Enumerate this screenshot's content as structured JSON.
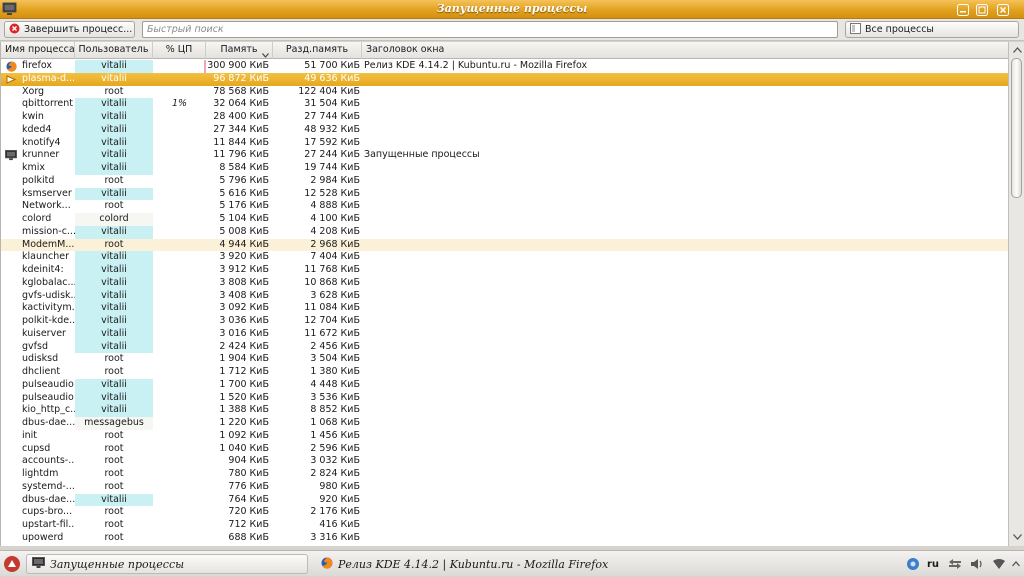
{
  "window": {
    "title": "Запущенные процессы",
    "app_icon": "monitor-icon",
    "buttons": [
      "minimize-icon",
      "maximize-icon",
      "close-icon"
    ],
    "accent": "#e2a21f"
  },
  "toolbar": {
    "kill_label": "Завершить процесс...",
    "search_placeholder": "Быстрый поиск",
    "search_value": "",
    "filter_label": "Все процессы"
  },
  "columns": {
    "name": "Имя процесса",
    "user": "Пользователь",
    "cpu": "% ЦП",
    "mem": "Память",
    "shared": "Разд.память",
    "title": "Заголовок окна"
  },
  "rows": [
    {
      "name": "firefox",
      "user": "vitalii",
      "cpu": "",
      "mem": "300 900 КиБ",
      "shared": "51 700 КиБ",
      "title": "Релиз KDE 4.14.2 |  Kubuntu.ru - Mozilla Firefox",
      "icon": "firefox-icon",
      "mem_frac": 1.0
    },
    {
      "name": "plasma-d...",
      "user": "vitalii",
      "cpu": "",
      "mem": "96 872 КиБ",
      "shared": "49 636 КиБ",
      "title": "",
      "icon": "plasma-icon",
      "mem_frac": 0.32,
      "selected": true
    },
    {
      "name": "Xorg",
      "user": "root",
      "cpu": "",
      "mem": "78 568 КиБ",
      "shared": "122 404 КиБ",
      "title": ""
    },
    {
      "name": "qbittorrent",
      "user": "vitalii",
      "cpu": "1%",
      "mem": "32 064 КиБ",
      "shared": "31 504 КиБ",
      "title": ""
    },
    {
      "name": "kwin",
      "user": "vitalii",
      "cpu": "",
      "mem": "28 400 КиБ",
      "shared": "27 744 КиБ",
      "title": ""
    },
    {
      "name": "kded4",
      "user": "vitalii",
      "cpu": "",
      "mem": "27 344 КиБ",
      "shared": "48 932 КиБ",
      "title": ""
    },
    {
      "name": "knotify4",
      "user": "vitalii",
      "cpu": "",
      "mem": "11 844 КиБ",
      "shared": "17 592 КиБ",
      "title": ""
    },
    {
      "name": "krunner",
      "user": "vitalii",
      "cpu": "",
      "mem": "11 796 КиБ",
      "shared": "27 244 КиБ",
      "title": "Запущенные процессы",
      "icon": "monitor-icon"
    },
    {
      "name": "kmix",
      "user": "vitalii",
      "cpu": "",
      "mem": "8 584 КиБ",
      "shared": "19 744 КиБ",
      "title": ""
    },
    {
      "name": "polkitd",
      "user": "root",
      "cpu": "",
      "mem": "5 796 КиБ",
      "shared": "2 984 КиБ",
      "title": ""
    },
    {
      "name": "ksmserver",
      "user": "vitalii",
      "cpu": "",
      "mem": "5 616 КиБ",
      "shared": "12 528 КиБ",
      "title": ""
    },
    {
      "name": "Network...",
      "user": "root",
      "cpu": "",
      "mem": "5 176 КиБ",
      "shared": "4 888 КиБ",
      "title": ""
    },
    {
      "name": "colord",
      "user": "colord",
      "cpu": "",
      "mem": "5 104 КиБ",
      "shared": "4 100 КиБ",
      "title": ""
    },
    {
      "name": "mission-c...",
      "user": "vitalii",
      "cpu": "",
      "mem": "5 008 КиБ",
      "shared": "4 208 КиБ",
      "title": ""
    },
    {
      "name": "ModemM...",
      "user": "root",
      "cpu": "",
      "mem": "4 944 КиБ",
      "shared": "2 968 КиБ",
      "title": "",
      "hover": true
    },
    {
      "name": "klauncher",
      "user": "vitalii",
      "cpu": "",
      "mem": "3 920 КиБ",
      "shared": "7 404 КиБ",
      "title": ""
    },
    {
      "name": "kdeinit4:",
      "user": "vitalii",
      "cpu": "",
      "mem": "3 912 КиБ",
      "shared": "11 768 КиБ",
      "title": ""
    },
    {
      "name": "kglobalac...",
      "user": "vitalii",
      "cpu": "",
      "mem": "3 808 КиБ",
      "shared": "10 868 КиБ",
      "title": ""
    },
    {
      "name": "gvfs-udisk...",
      "user": "vitalii",
      "cpu": "",
      "mem": "3 408 КиБ",
      "shared": "3 628 КиБ",
      "title": ""
    },
    {
      "name": "kactivitym...",
      "user": "vitalii",
      "cpu": "",
      "mem": "3 092 КиБ",
      "shared": "11 084 КиБ",
      "title": ""
    },
    {
      "name": "polkit-kde...",
      "user": "vitalii",
      "cpu": "",
      "mem": "3 036 КиБ",
      "shared": "12 704 КиБ",
      "title": ""
    },
    {
      "name": "kuiserver",
      "user": "vitalii",
      "cpu": "",
      "mem": "3 016 КиБ",
      "shared": "11 672 КиБ",
      "title": ""
    },
    {
      "name": "gvfsd",
      "user": "vitalii",
      "cpu": "",
      "mem": "2 424 КиБ",
      "shared": "2 456 КиБ",
      "title": ""
    },
    {
      "name": "udisksd",
      "user": "root",
      "cpu": "",
      "mem": "1 904 КиБ",
      "shared": "3 504 КиБ",
      "title": ""
    },
    {
      "name": "dhclient",
      "user": "root",
      "cpu": "",
      "mem": "1 712 КиБ",
      "shared": "1 380 КиБ",
      "title": ""
    },
    {
      "name": "pulseaudio",
      "user": "vitalii",
      "cpu": "",
      "mem": "1 700 КиБ",
      "shared": "4 448 КиБ",
      "title": ""
    },
    {
      "name": "pulseaudio",
      "user": "vitalii",
      "cpu": "",
      "mem": "1 520 КиБ",
      "shared": "3 536 КиБ",
      "title": ""
    },
    {
      "name": "kio_http_c...",
      "user": "vitalii",
      "cpu": "",
      "mem": "1 388 КиБ",
      "shared": "8 852 КиБ",
      "title": ""
    },
    {
      "name": "dbus-dae...",
      "user": "messagebus",
      "cpu": "",
      "mem": "1 220 КиБ",
      "shared": "1 068 КиБ",
      "title": ""
    },
    {
      "name": "init",
      "user": "root",
      "cpu": "",
      "mem": "1 092 КиБ",
      "shared": "1 456 КиБ",
      "title": ""
    },
    {
      "name": "cupsd",
      "user": "root",
      "cpu": "",
      "mem": "1 040 КиБ",
      "shared": "2 596 КиБ",
      "title": ""
    },
    {
      "name": "accounts-...",
      "user": "root",
      "cpu": "",
      "mem": "904 КиБ",
      "shared": "3 032 КиБ",
      "title": ""
    },
    {
      "name": "lightdm",
      "user": "root",
      "cpu": "",
      "mem": "780 КиБ",
      "shared": "2 824 КиБ",
      "title": ""
    },
    {
      "name": "systemd-...",
      "user": "root",
      "cpu": "",
      "mem": "776 КиБ",
      "shared": "980 КиБ",
      "title": ""
    },
    {
      "name": "dbus-dae...",
      "user": "vitalii",
      "cpu": "",
      "mem": "764 КиБ",
      "shared": "920 КиБ",
      "title": ""
    },
    {
      "name": "cups-bro...",
      "user": "root",
      "cpu": "",
      "mem": "720 КиБ",
      "shared": "2 176 КиБ",
      "title": ""
    },
    {
      "name": "upstart-fil...",
      "user": "root",
      "cpu": "",
      "mem": "712 КиБ",
      "shared": "416 КиБ",
      "title": ""
    },
    {
      "name": "upowerd",
      "user": "root",
      "cpu": "",
      "mem": "688 КиБ",
      "shared": "3 316 КиБ",
      "title": ""
    }
  ],
  "taskbar": {
    "task1_label": "Запущенные процессы",
    "task2_label": "Релиз KDE 4.14.2 |  Kubuntu.ru - Mozilla Firefox",
    "keyboard_layout": "ru",
    "tray_icons": [
      "notifications-icon",
      "network-icon",
      "volume-icon",
      "wifi-icon",
      "expand-tray-icon"
    ]
  }
}
